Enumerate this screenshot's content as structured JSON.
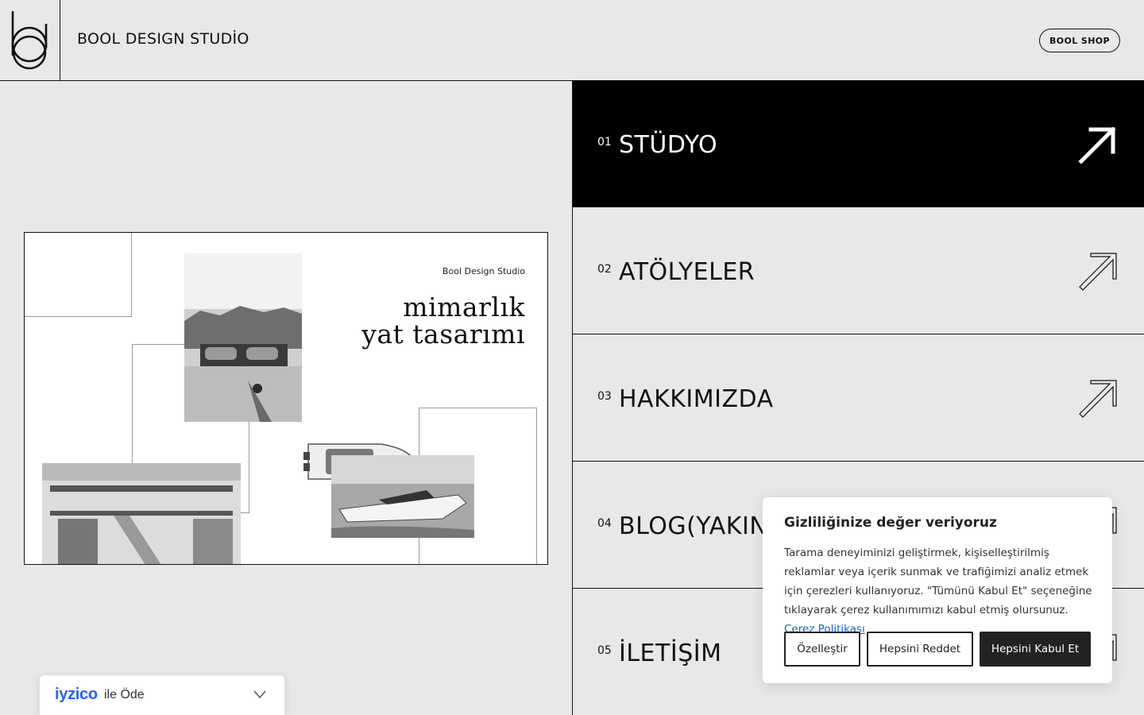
{
  "header": {
    "brand": "BOOL DESIGN STUDİO",
    "shop_label": "BOOL SHOP"
  },
  "collage": {
    "studio_name": "Bool Design Studio",
    "line1": "mimarlık",
    "line2": "yat tasarımı"
  },
  "nav": {
    "items": [
      {
        "num": "01",
        "label": "STÜDYO",
        "active": true
      },
      {
        "num": "02",
        "label": "ATÖLYELER",
        "active": false
      },
      {
        "num": "03",
        "label": "HAKKIMIZDA",
        "active": false
      },
      {
        "num": "04",
        "label": "BLOG(YAKINDA)",
        "active": false
      },
      {
        "num": "05",
        "label": "İLETİŞİM",
        "active": false
      }
    ]
  },
  "iyzico": {
    "logo": "iyzico",
    "text": "ile Öde",
    "chevron_icon": "chevron-down-icon"
  },
  "cookie": {
    "title": "Gizliliğinize değer veriyoruz",
    "body": "Tarama deneyiminizi geliştirmek, kişiselleştirilmiş reklamlar veya içerik sunmak ve trafiğimizi analiz etmek için çerezleri kullanıyoruz. \"Tümünü Kabul Et\" seçeneğine tıklayarak çerez kullanımımızı kabul etmiş olursunuz.",
    "link": "Çerez Politikası",
    "customize_label": "Özelleştir",
    "reject_label": "Hepsini Reddet",
    "accept_label": "Hepsini Kabul Et"
  },
  "colors": {
    "background": "#e8e8e8",
    "active_nav": "#000000",
    "accept_button": "#222222",
    "link": "#1863dc",
    "iyzico_brand": "#1e64ff"
  }
}
